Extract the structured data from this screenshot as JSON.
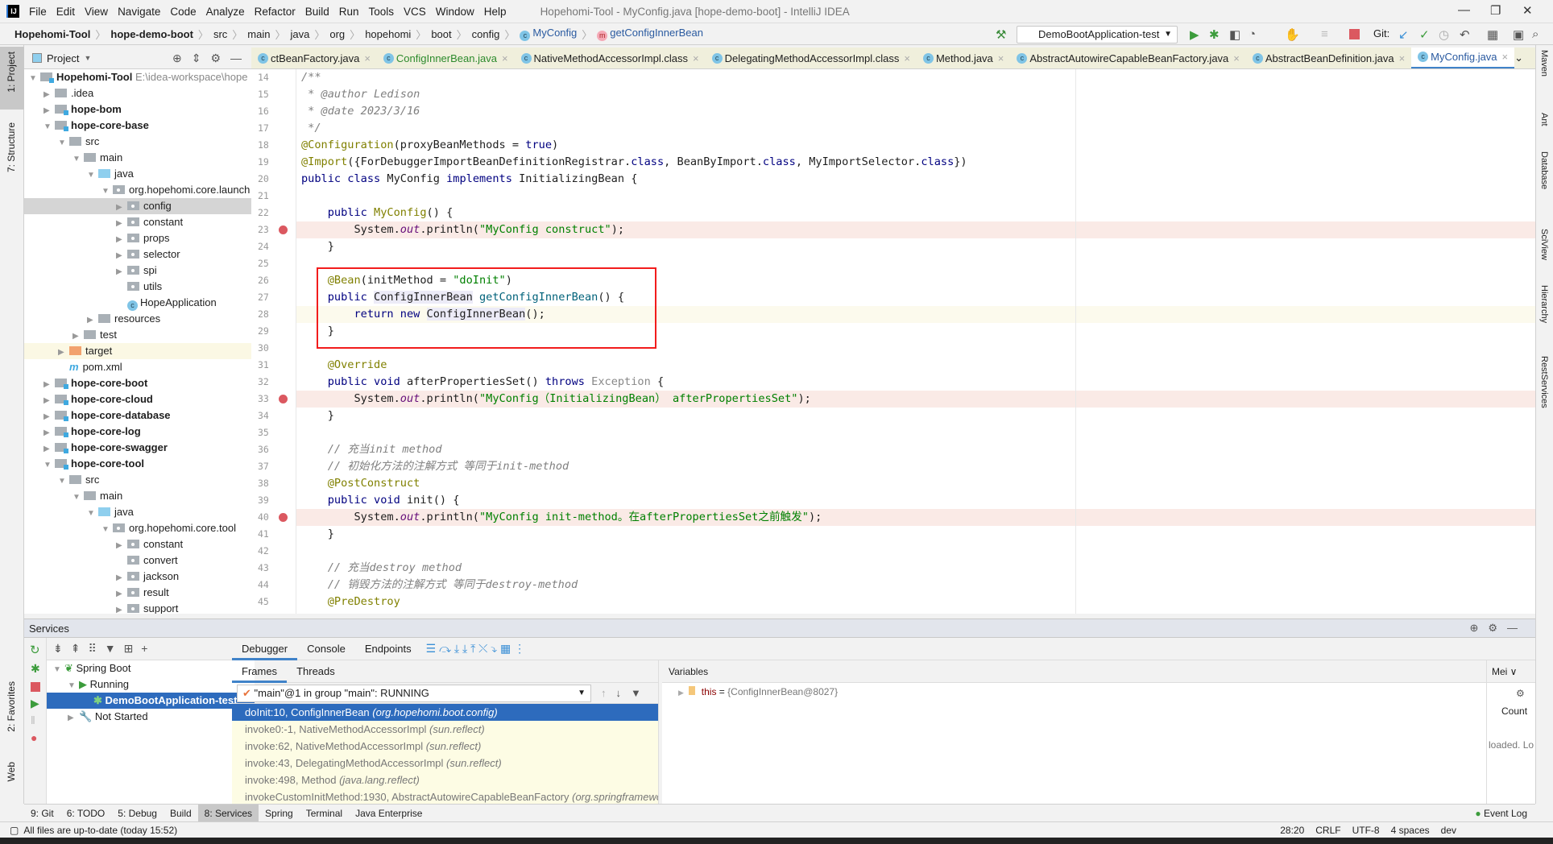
{
  "app": {
    "title": "Hopehomi-Tool - MyConfig.java [hope-demo-boot] - IntelliJ IDEA",
    "logo": "IJ"
  },
  "menu": [
    "File",
    "Edit",
    "View",
    "Navigate",
    "Code",
    "Analyze",
    "Refactor",
    "Build",
    "Run",
    "Tools",
    "VCS",
    "Window",
    "Help"
  ],
  "breadcrumb": [
    {
      "t": "Hopehomi-Tool",
      "b": true
    },
    {
      "t": "hope-demo-boot",
      "b": true
    },
    {
      "t": "src"
    },
    {
      "t": "main"
    },
    {
      "t": "java"
    },
    {
      "t": "org"
    },
    {
      "t": "hopehomi"
    },
    {
      "t": "boot"
    },
    {
      "t": "config"
    },
    {
      "t": "MyConfig",
      "icon": "class"
    },
    {
      "t": "getConfigInnerBean",
      "icon": "method"
    }
  ],
  "toolbar": {
    "run_config": "DemoBootApplication-test",
    "git_label": "Git:"
  },
  "left_strip": [
    "1: Project",
    "7: Structure",
    "2: Favorites",
    "Web"
  ],
  "right_strip": [
    "Maven",
    "Ant",
    "Database",
    "SciView",
    "Hierarchy",
    "RestServices"
  ],
  "project": {
    "header": "Project",
    "tree": [
      {
        "d": 0,
        "a": "▼",
        "i": "mod",
        "t": "Hopehomi-Tool",
        "b": true,
        "extra": "E:\\idea-workspace\\hope"
      },
      {
        "d": 1,
        "a": "▶",
        "i": "",
        "t": ".idea"
      },
      {
        "d": 1,
        "a": "▶",
        "i": "mod",
        "t": "hope-bom",
        "b": true
      },
      {
        "d": 1,
        "a": "▼",
        "i": "mod",
        "t": "hope-core-base",
        "b": true
      },
      {
        "d": 2,
        "a": "▼",
        "i": "",
        "t": "src"
      },
      {
        "d": 3,
        "a": "▼",
        "i": "",
        "t": "main"
      },
      {
        "d": 4,
        "a": "▼",
        "i": "src",
        "t": "java"
      },
      {
        "d": 5,
        "a": "▼",
        "i": "pkg",
        "t": "org.hopehomi.core.launch"
      },
      {
        "d": 6,
        "a": "▶",
        "i": "pkg",
        "t": "config",
        "sel": true
      },
      {
        "d": 6,
        "a": "▶",
        "i": "pkg",
        "t": "constant"
      },
      {
        "d": 6,
        "a": "▶",
        "i": "pkg",
        "t": "props"
      },
      {
        "d": 6,
        "a": "▶",
        "i": "pkg",
        "t": "selector"
      },
      {
        "d": 6,
        "a": "▶",
        "i": "pkg",
        "t": "spi"
      },
      {
        "d": 6,
        "a": "",
        "i": "pkg",
        "t": "utils"
      },
      {
        "d": 6,
        "a": "",
        "i": "class",
        "t": "HopeApplication"
      },
      {
        "d": 4,
        "a": "▶",
        "i": "",
        "t": "resources"
      },
      {
        "d": 3,
        "a": "▶",
        "i": "",
        "t": "test"
      },
      {
        "d": 2,
        "a": "▶",
        "i": "tgt",
        "t": "target",
        "excl": true
      },
      {
        "d": 2,
        "a": "",
        "i": "maven",
        "t": "pom.xml"
      },
      {
        "d": 1,
        "a": "▶",
        "i": "mod",
        "t": "hope-core-boot",
        "b": true
      },
      {
        "d": 1,
        "a": "▶",
        "i": "mod",
        "t": "hope-core-cloud",
        "b": true
      },
      {
        "d": 1,
        "a": "▶",
        "i": "mod",
        "t": "hope-core-database",
        "b": true
      },
      {
        "d": 1,
        "a": "▶",
        "i": "mod",
        "t": "hope-core-log",
        "b": true
      },
      {
        "d": 1,
        "a": "▶",
        "i": "mod",
        "t": "hope-core-swagger",
        "b": true
      },
      {
        "d": 1,
        "a": "▼",
        "i": "mod",
        "t": "hope-core-tool",
        "b": true
      },
      {
        "d": 2,
        "a": "▼",
        "i": "",
        "t": "src"
      },
      {
        "d": 3,
        "a": "▼",
        "i": "",
        "t": "main"
      },
      {
        "d": 4,
        "a": "▼",
        "i": "src",
        "t": "java"
      },
      {
        "d": 5,
        "a": "▼",
        "i": "pkg",
        "t": "org.hopehomi.core.tool"
      },
      {
        "d": 6,
        "a": "▶",
        "i": "pkg",
        "t": "constant"
      },
      {
        "d": 6,
        "a": "",
        "i": "pkg",
        "t": "convert"
      },
      {
        "d": 6,
        "a": "▶",
        "i": "pkg",
        "t": "jackson"
      },
      {
        "d": 6,
        "a": "▶",
        "i": "pkg",
        "t": "result"
      },
      {
        "d": 6,
        "a": "▶",
        "i": "pkg",
        "t": "support"
      }
    ]
  },
  "tabs": [
    {
      "t": "ctBeanFactory.java"
    },
    {
      "t": "ConfigInnerBean.java",
      "green": true
    },
    {
      "t": "NativeMethodAccessorImpl.class"
    },
    {
      "t": "DelegatingMethodAccessorImpl.class"
    },
    {
      "t": "Method.java"
    },
    {
      "t": "AbstractAutowireCapableBeanFactory.java"
    },
    {
      "t": "AbstractBeanDefinition.java"
    },
    {
      "t": "MyConfig.java",
      "active": true
    }
  ],
  "code": [
    {
      "n": "14",
      "k": [
        [
          "cm",
          "/**"
        ]
      ]
    },
    {
      "n": "15",
      "k": [
        [
          "cm",
          " * @author Ledison"
        ]
      ]
    },
    {
      "n": "16",
      "k": [
        [
          "cm",
          " * @date 2023/3/16"
        ]
      ]
    },
    {
      "n": "17",
      "k": [
        [
          "cm",
          " */"
        ]
      ]
    },
    {
      "n": "18",
      "k": [
        [
          "an",
          "@Configuration"
        ],
        [
          "",
          "(proxyBeanMethods = "
        ],
        [
          "kw",
          "true"
        ],
        [
          "",
          ")"
        ]
      ]
    },
    {
      "n": "19",
      "k": [
        [
          "an",
          "@Import"
        ],
        [
          "",
          "({ForDebuggerImportBeanDefinitionRegistrar."
        ],
        [
          "kw",
          "class"
        ],
        [
          "",
          ", BeanByImport."
        ],
        [
          "kw",
          "class"
        ],
        [
          "",
          ", MyImportSelector."
        ],
        [
          "kw",
          "class"
        ],
        [
          "",
          "})"
        ]
      ]
    },
    {
      "n": "20",
      "k": [
        [
          "kw",
          "public class "
        ],
        [
          "",
          "MyConfig "
        ],
        [
          "kw",
          "implements "
        ],
        [
          "",
          "InitializingBean {"
        ]
      ]
    },
    {
      "n": "21",
      "k": []
    },
    {
      "n": "22",
      "k": [
        [
          "",
          "    "
        ],
        [
          "kw",
          "public "
        ],
        [
          "an",
          "MyConfig"
        ],
        [
          "",
          "() {"
        ]
      ]
    },
    {
      "n": "23",
      "bp": true,
      "k": [
        [
          "",
          "        System."
        ],
        [
          "sf",
          "out"
        ],
        [
          "",
          ".println("
        ],
        [
          "st",
          "\"MyConfig construct\""
        ],
        [
          "",
          ");"
        ]
      ]
    },
    {
      "n": "24",
      "k": [
        [
          "",
          "    }"
        ]
      ]
    },
    {
      "n": "25",
      "k": []
    },
    {
      "n": "26",
      "k": [
        [
          "",
          "    "
        ],
        [
          "an",
          "@Bean"
        ],
        [
          "",
          "(initMethod = "
        ],
        [
          "st",
          "\"doInit\""
        ],
        [
          "",
          ")"
        ]
      ]
    },
    {
      "n": "27",
      "k": [
        [
          "",
          "    "
        ],
        [
          "kw",
          "public "
        ],
        [
          "hl",
          "ConfigInnerBean"
        ],
        [
          "",
          " "
        ],
        [
          "fn",
          "getConfigInnerBean"
        ],
        [
          "",
          "() {"
        ]
      ]
    },
    {
      "n": "28",
      "cur": true,
      "k": [
        [
          "",
          "        "
        ],
        [
          "kw",
          "return new "
        ],
        [
          "hl",
          "ConfigInnerBean"
        ],
        [
          "",
          "();"
        ]
      ]
    },
    {
      "n": "29",
      "k": [
        [
          "",
          "    }"
        ]
      ]
    },
    {
      "n": "30",
      "k": []
    },
    {
      "n": "31",
      "k": [
        [
          "",
          "    "
        ],
        [
          "an",
          "@Override"
        ]
      ]
    },
    {
      "n": "32",
      "k": [
        [
          "",
          "    "
        ],
        [
          "kw",
          "public void "
        ],
        [
          "",
          "afterPropertiesSet() "
        ],
        [
          "kw",
          "throws "
        ],
        [
          "muted",
          "Exception"
        ],
        [
          "",
          " {"
        ]
      ]
    },
    {
      "n": "33",
      "bp": true,
      "k": [
        [
          "",
          "        System."
        ],
        [
          "sf",
          "out"
        ],
        [
          "",
          ".println("
        ],
        [
          "st",
          "\"MyConfig（InitializingBean） afterPropertiesSet\""
        ],
        [
          "",
          ");"
        ]
      ]
    },
    {
      "n": "34",
      "k": [
        [
          "",
          "    }"
        ]
      ]
    },
    {
      "n": "35",
      "k": []
    },
    {
      "n": "36",
      "k": [
        [
          "",
          "    "
        ],
        [
          "cm",
          "// 充当init method"
        ]
      ]
    },
    {
      "n": "37",
      "k": [
        [
          "",
          "    "
        ],
        [
          "cm",
          "// 初始化方法的注解方式 等同于init-method"
        ]
      ]
    },
    {
      "n": "38",
      "k": [
        [
          "",
          "    "
        ],
        [
          "an",
          "@PostConstruct"
        ]
      ]
    },
    {
      "n": "39",
      "k": [
        [
          "",
          "    "
        ],
        [
          "kw",
          "public void "
        ],
        [
          "",
          "init() {"
        ]
      ]
    },
    {
      "n": "40",
      "bp": true,
      "k": [
        [
          "",
          "        System."
        ],
        [
          "sf",
          "out"
        ],
        [
          "",
          ".println("
        ],
        [
          "st",
          "\"MyConfig init-method。在afterPropertiesSet之前触发\""
        ],
        [
          "",
          ");"
        ]
      ]
    },
    {
      "n": "41",
      "k": [
        [
          "",
          "    }"
        ]
      ]
    },
    {
      "n": "42",
      "k": []
    },
    {
      "n": "43",
      "k": [
        [
          "",
          "    "
        ],
        [
          "cm",
          "// 充当destroy method"
        ]
      ]
    },
    {
      "n": "44",
      "k": [
        [
          "",
          "    "
        ],
        [
          "cm",
          "// 销毁方法的注解方式 等同于destroy-method"
        ]
      ]
    },
    {
      "n": "45",
      "k": [
        [
          "",
          "    "
        ],
        [
          "an",
          "@PreDestroy"
        ]
      ]
    }
  ],
  "services": {
    "title": "Services",
    "tree": [
      {
        "d": 0,
        "a": "▼",
        "t": "Spring Boot"
      },
      {
        "d": 1,
        "a": "▼",
        "t": "Running"
      },
      {
        "d": 2,
        "a": "",
        "t": "DemoBootApplication-test",
        "sel": true
      },
      {
        "d": 1,
        "a": "▶",
        "t": "Not Started"
      }
    ],
    "debug_tabs": [
      "Debugger",
      "Console",
      "Endpoints"
    ],
    "frame_tabs": [
      "Frames",
      "Threads"
    ],
    "thread": "\"main\"@1 in group \"main\": RUNNING",
    "frames": [
      {
        "m": "doInit:10, ConfigInnerBean ",
        "p": "(org.hopehomi.boot.config)",
        "sel": true
      },
      {
        "m": "invoke0:-1, NativeMethodAccessorImpl ",
        "p": "(sun.reflect)"
      },
      {
        "m": "invoke:62, NativeMethodAccessorImpl ",
        "p": "(sun.reflect)"
      },
      {
        "m": "invoke:43, DelegatingMethodAccessorImpl ",
        "p": "(sun.reflect)"
      },
      {
        "m": "invoke:498, Method ",
        "p": "(java.lang.reflect)"
      },
      {
        "m": "invokeCustomInitMethod:1930, AbstractAutowireCapableBeanFactory ",
        "p": "(org.springframework"
      }
    ],
    "variables_title": "Variables",
    "var": {
      "name": "this",
      "eq": " = ",
      "value": "{ConfigInnerBean@8027}"
    },
    "memory": {
      "tab": "Mei",
      "col": "Count",
      "msg": "loaded. Lo"
    }
  },
  "bottom_tabs": [
    "9: Git",
    "6: TODO",
    "5: Debug",
    "Build",
    "8: Services",
    "Spring",
    "Terminal",
    "Java Enterprise"
  ],
  "event_log": "Event Log",
  "status": {
    "msg": "All files are up-to-date (today 15:52)",
    "pos": "28:20",
    "eol": "CRLF",
    "enc": "UTF-8",
    "indent": "4 spaces",
    "branch": "dev"
  }
}
